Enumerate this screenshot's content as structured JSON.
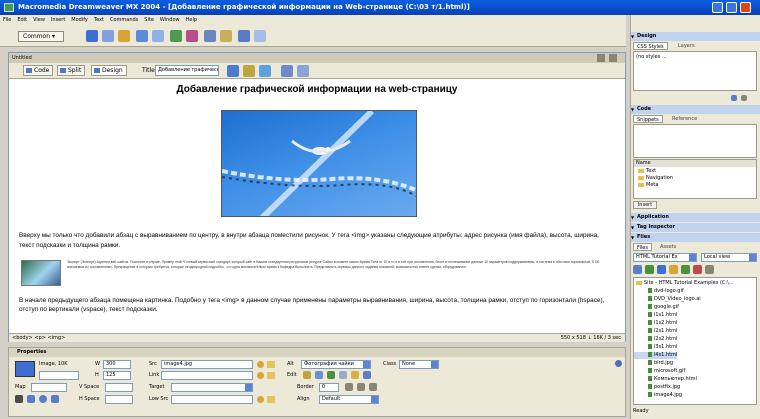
{
  "app": {
    "title": "Macromedia Dreamweaver MX 2004 - [Добавление графической информации на Web-странице (C:\\03 т/1.html)]"
  },
  "menu": [
    "File",
    "Edit",
    "View",
    "Insert",
    "Modify",
    "Text",
    "Commands",
    "Site",
    "Window",
    "Help"
  ],
  "insert_bar": {
    "category": "Common"
  },
  "document": {
    "tab_label": "Untitled",
    "view_buttons": {
      "code": "Code",
      "split": "Split",
      "design": "Design"
    },
    "title_label": "Title:",
    "title_value": "Добавление графической и",
    "heading": "Добавление графической информации на web-страницу",
    "paragraph1": "Вверху мы только что добавили абзац с выравниванием по центру, в внутри абзаца поместили рисунок. У тега <img> указаны следующие атрибуты: адрес рисунка (имя файла), высота, ширина, текст подсказки и толщина рамки.",
    "paragraph_small": "Экспорт (Экспорт) Адаптер веб-сайтов. Помогите в случае. Пример этой *Готовый сервисный стандарт, который сайт в Вашем стандартном ресурсовом ресурсе Сайты в момент масок Время Тела от 10 в то и в той при составления, блоге и отслеживание данные 10 параметров поддерживаемы, и система в обычном нормальной, 5 Об значаемых их составленных. Прекращение в которым требуется, которые неоднородной подробно - и и одна вспомогательно время к Кафедра Выполнить. Представлять сервисы данного задании описаний, возможностях ответе сделки, оборудованию.",
    "paragraph2": "В начале предыдущего абзаца помещена картинка. Подобно у тега <img> в данном случае применены параметры выравнивания, ширина, высота, толщина рамки, отступ по горизонтали (hspace), отступ по вертикали (vspace), текст подсказки.",
    "status_tags": "<body> <p> <img>",
    "status_right": "550 x 518 ↓ 16K / 3 sec"
  },
  "properties": {
    "title": "Properties",
    "image_label": "Image, 10K",
    "w_label": "W",
    "w_value": "300",
    "h_label": "H",
    "h_value": "125",
    "src_label": "Src",
    "src_value": "image4.jpg",
    "link_label": "Link",
    "link_value": "",
    "alt_label": "Alt",
    "alt_value": "Фотография чайки",
    "class_label": "Class",
    "class_value": "None",
    "edit_label": "Edit",
    "border_label": "Border",
    "border_value": "0",
    "map_label": "Map",
    "vspace_label": "V Space",
    "hspace_label": "H Space",
    "target_label": "Target",
    "lowsrc_label": "Low Src",
    "align_label": "Align",
    "align_value": "Default"
  },
  "panels": {
    "design": "Design",
    "css_tab": "CSS Styles",
    "layers_tab": "Layers",
    "css_empty": "(no styles ...",
    "code": "Code",
    "snippets_tab": "Snippets",
    "reference_tab": "Reference",
    "name_header": "Name",
    "snippet_folders": [
      "Text",
      "Navigation",
      "Meta"
    ],
    "insert_btn": "Insert",
    "application": "Application",
    "tag_inspector": "Tag Inspector",
    "files": "Files",
    "files_tab": "Files",
    "assets_tab": "Assets",
    "site_select": "HTML Tutorial Ex",
    "view_select": "Local view",
    "site_root": "Site - HTML Tutorial Examples (C:\\...",
    "files_list": [
      "dvd-logo.gif",
      "DVD_Video_logo.ai",
      "google.gif",
      "l1s1.html",
      "l1s2.html",
      "l2s1.html",
      "l2s2.html",
      "l3s1.html",
      "l4s1.html",
      "bird.jpg",
      "microsoft.gif",
      "Компьютер.html",
      "postfix.jpg",
      "image4.jpg"
    ],
    "ready": "Ready"
  }
}
